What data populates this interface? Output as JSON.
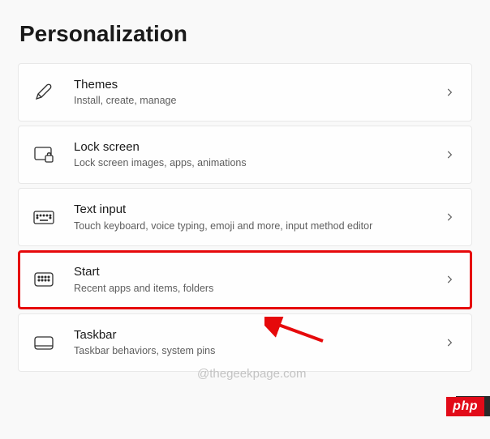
{
  "page": {
    "title": "Personalization"
  },
  "items": [
    {
      "title": "Themes",
      "subtitle": "Install, create, manage",
      "icon": "pen-icon",
      "highlighted": false
    },
    {
      "title": "Lock screen",
      "subtitle": "Lock screen images, apps, animations",
      "icon": "lock-screen-icon",
      "highlighted": false
    },
    {
      "title": "Text input",
      "subtitle": "Touch keyboard, voice typing, emoji and more, input method editor",
      "icon": "keyboard-icon",
      "highlighted": false
    },
    {
      "title": "Start",
      "subtitle": "Recent apps and items, folders",
      "icon": "start-icon",
      "highlighted": true
    },
    {
      "title": "Taskbar",
      "subtitle": "Taskbar behaviors, system pins",
      "icon": "taskbar-icon",
      "highlighted": false
    }
  ],
  "watermark": "@thegeekpage.com",
  "badge": "php"
}
